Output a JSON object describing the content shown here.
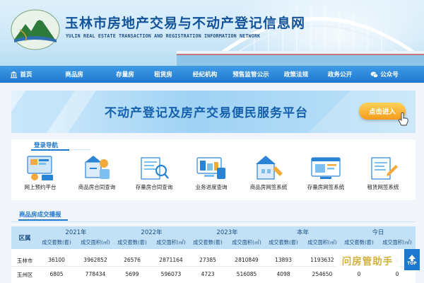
{
  "header": {
    "title": "玉林市房地产交易与不动产登记信息网",
    "subtitle": "YULIN REAL ESTATE TRANSACTION AND REGISTRATION INFORMATION NETWORK"
  },
  "nav": {
    "items": [
      {
        "label": "首页",
        "icon": "bank-icon"
      },
      {
        "label": "商品房"
      },
      {
        "label": "存量房"
      },
      {
        "label": "租赁房"
      },
      {
        "label": "经纪机构"
      },
      {
        "label": "预售监管公示"
      },
      {
        "label": "政策法规"
      },
      {
        "label": "政务公开"
      },
      {
        "label": "公众号",
        "icon": "wechat-icon"
      }
    ]
  },
  "banner": {
    "text": "不动产登记及房产交易便民服务平台",
    "button": "点击进入"
  },
  "login_nav": {
    "title": "登录导航",
    "services": [
      {
        "label": "网上预约平台",
        "icon": "online-booking-icon"
      },
      {
        "label": "商品房合同查询",
        "icon": "new-house-contract-icon"
      },
      {
        "label": "存量房合同查询",
        "icon": "resale-contract-icon"
      },
      {
        "label": "业务进度查询",
        "icon": "progress-query-icon"
      },
      {
        "label": "商品房网签系统",
        "icon": "new-house-signing-icon"
      },
      {
        "label": "存量房网签系统",
        "icon": "resale-signing-icon"
      },
      {
        "label": "租赁网签系统",
        "icon": "rental-signing-icon"
      }
    ]
  },
  "stats": {
    "title": "商品房成交播报",
    "region_header": "区属",
    "periods": [
      "2021年",
      "2022年",
      "2023年",
      "本年",
      "今日"
    ],
    "metric_headers": [
      "成交套数(套)",
      "成交面积(㎡)"
    ],
    "rows": [
      {
        "region": "玉林市",
        "values": [
          "36100",
          "3962852",
          "26576",
          "2871164",
          "27385",
          "2810849",
          "13893",
          "1193632",
          "0",
          "0"
        ]
      },
      {
        "region": "玉州区",
        "values": [
          "6805",
          "778434",
          "5699",
          "596073",
          "4723",
          "516085",
          "4098",
          "254650",
          "0",
          "0"
        ]
      }
    ]
  },
  "watermark": {
    "text": "问房管助手"
  },
  "top_button": {
    "label": "TOP"
  }
}
